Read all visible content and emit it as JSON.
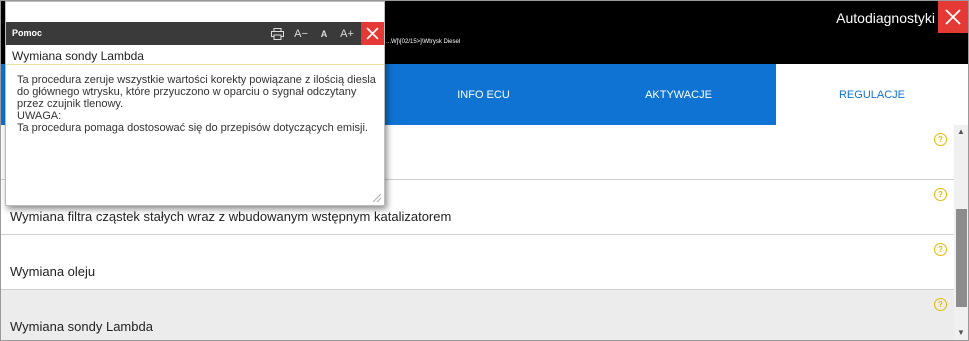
{
  "header": {
    "app_title": "Autodiagnostyki",
    "breadcrumb": "...W]\\[02/15>]\\Wtrysk Diesel"
  },
  "tabs": [
    {
      "label": "INFO ECU"
    },
    {
      "label": "AKTYWACJE"
    },
    {
      "label": "REGULACJE",
      "active": true
    }
  ],
  "list": {
    "items": [
      {
        "label": ""
      },
      {
        "label": "Wymiana filtra cząstek stałych wraz z wbudowanym wstępnym katalizatorem"
      },
      {
        "label": "Wymiana oleju"
      },
      {
        "label": "Wymiana sondy Lambda",
        "selected": true
      }
    ],
    "help_glyph": "?"
  },
  "help_popup": {
    "title": "Pomoc",
    "tools": {
      "font_decrease": "A−",
      "font_default": "A",
      "font_increase": "A+"
    },
    "subtitle": "Wymiana sondy Lambda",
    "paragraphs": [
      "Ta procedura zeruje wszystkie wartości korekty powiązane z ilością diesla do głównego wtrysku, które przyuczono w oparciu o sygnał odczytany przez czujnik tlenowy.",
      "UWAGA:",
      "Ta procedura pomaga dostosować się do przepisów dotyczących emisji."
    ]
  },
  "colors": {
    "accent_blue": "#0e73d3",
    "close_red": "#e53935",
    "help_yellow": "#e6b800",
    "header_black": "#000000"
  },
  "icons": [
    "close-icon",
    "print-icon",
    "help-icon",
    "resize-grip-icon",
    "scroll-up-icon",
    "scroll-down-icon"
  ]
}
